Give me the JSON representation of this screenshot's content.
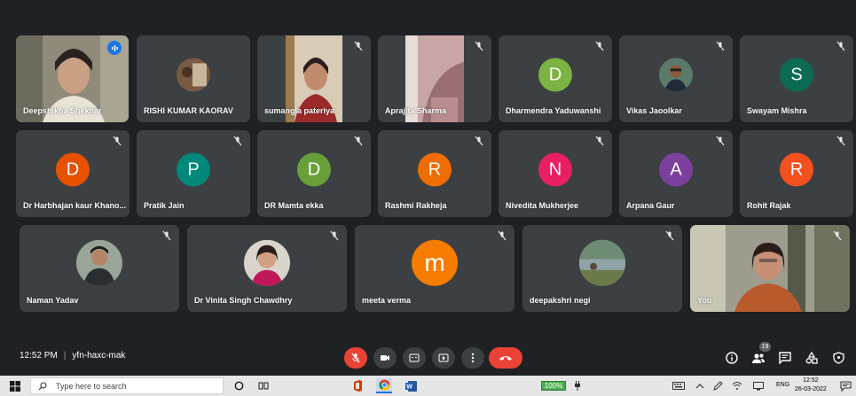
{
  "participants_row1": [
    {
      "name": "Deepshikha Shekhar",
      "kind": "video",
      "speaking": true
    },
    {
      "name": "RISHI KUMAR KAORAV",
      "kind": "photo"
    },
    {
      "name": "sumangla pateriya",
      "kind": "video"
    },
    {
      "name": "Aprajita Sharma",
      "kind": "video"
    },
    {
      "name": "Dharmendra Yaduwanshi",
      "kind": "letter",
      "letter": "D",
      "color": "#7cb342"
    },
    {
      "name": "Vikas Jaoolkar",
      "kind": "photo"
    },
    {
      "name": "Swayam Mishra",
      "kind": "letter",
      "letter": "S",
      "color": "#0b6b55"
    }
  ],
  "participants_row2": [
    {
      "name": "Dr Harbhajan kaur Khano...",
      "letter": "D",
      "color": "#e65100"
    },
    {
      "name": "Pratik Jain",
      "letter": "P",
      "color": "#00897b"
    },
    {
      "name": "DR Mamta ekka",
      "letter": "D",
      "color": "#689f38"
    },
    {
      "name": "Rashmi Rakheja",
      "letter": "R",
      "color": "#ef6c00"
    },
    {
      "name": "Nivedita Mukherjee",
      "letter": "N",
      "color": "#e91e63"
    },
    {
      "name": "Arpana Gaur",
      "letter": "A",
      "color": "#7b3f9e"
    },
    {
      "name": "Rohit Rajak",
      "letter": "R",
      "color": "#f4511e"
    }
  ],
  "participants_row3": [
    {
      "name": "Naman Yadav",
      "kind": "photo"
    },
    {
      "name": "Dr Vinita Singh Chawdhry",
      "kind": "photo"
    },
    {
      "name": "meeta verma",
      "kind": "letter",
      "letter": "m",
      "color": "#f57c00"
    },
    {
      "name": "deepakshri negi",
      "kind": "photo"
    },
    {
      "name": "You",
      "kind": "video"
    }
  ],
  "meeting": {
    "time": "12:52 PM",
    "separator": "|",
    "code": "yfn-haxc-mak"
  },
  "participant_count": "19",
  "taskbar": {
    "search_placeholder": "Type here to search",
    "battery": "100%",
    "lang": "ENG",
    "time": "12:52",
    "date": "26-03-2022"
  },
  "colors": {
    "background": "#202124",
    "tile": "#3c4043",
    "end_call": "#ea4335",
    "active_outline": "#8ab4f8"
  }
}
